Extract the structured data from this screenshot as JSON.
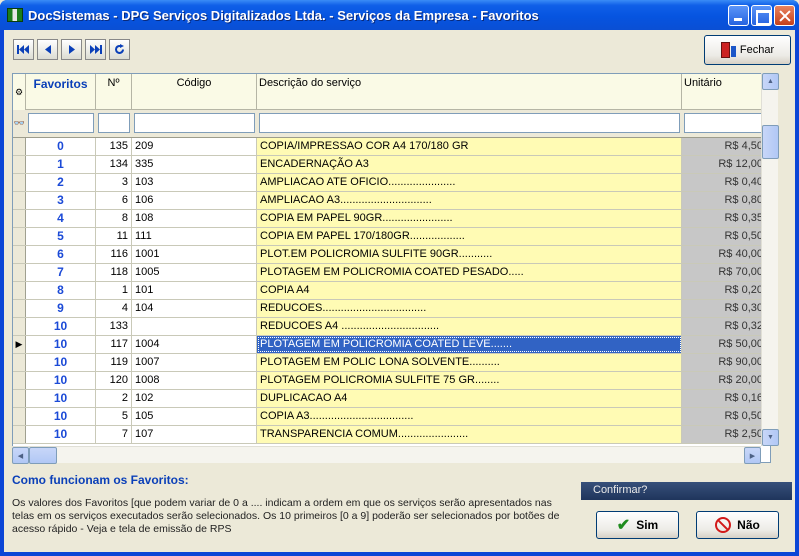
{
  "window": {
    "title": "DocSistemas - DPG Serviços Digitalizados Ltda. - Serviços da Empresa - Favoritos"
  },
  "toolbar": {
    "nav_icons": [
      "first-record-icon",
      "prior-record-icon",
      "next-record-icon",
      "last-record-icon",
      "refresh-icon"
    ],
    "close_label": "Fechar"
  },
  "grid": {
    "columns": [
      "Favoritos",
      "Nº",
      "Código",
      "Descrição do serviço",
      "Unitário"
    ],
    "selected_row": 11,
    "rows": [
      {
        "fav": "0",
        "n": "135",
        "cod": "209",
        "desc": "COPIA/IMPRESSAO COR A4 170/180 GR",
        "unit": "R$ 4,50"
      },
      {
        "fav": "1",
        "n": "134",
        "cod": "335",
        "desc": "ENCADERNAÇÃO A3",
        "unit": "R$ 12,00"
      },
      {
        "fav": "2",
        "n": "3",
        "cod": "103",
        "desc": "AMPLIACAO ATE OFICIO......................",
        "unit": "R$ 0,40"
      },
      {
        "fav": "3",
        "n": "6",
        "cod": "106",
        "desc": "AMPLIACAO A3..............................",
        "unit": "R$ 0,80"
      },
      {
        "fav": "4",
        "n": "8",
        "cod": "108",
        "desc": "COPIA EM PAPEL 90GR.......................",
        "unit": "R$ 0,35"
      },
      {
        "fav": "5",
        "n": "11",
        "cod": "111",
        "desc": "COPIA EM PAPEL 170/180GR..................",
        "unit": "R$ 0,50"
      },
      {
        "fav": "6",
        "n": "116",
        "cod": "1001",
        "desc": "PLOT.EM POLICROMIA SULFITE 90GR...........",
        "unit": "R$ 40,00"
      },
      {
        "fav": "7",
        "n": "118",
        "cod": "1005",
        "desc": "PLOTAGEM EM POLICROMIA COATED PESADO.....",
        "unit": "R$ 70,00"
      },
      {
        "fav": "8",
        "n": "1",
        "cod": "101",
        "desc": "COPIA A4",
        "unit": "R$ 0,20"
      },
      {
        "fav": "9",
        "n": "4",
        "cod": "104",
        "desc": "REDUCOES..................................",
        "unit": "R$ 0,30"
      },
      {
        "fav": "10",
        "n": "133",
        "cod": "",
        "desc": "REDUCOES A4 ................................",
        "unit": "R$ 0,32"
      },
      {
        "fav": "10",
        "n": "117",
        "cod": "1004",
        "desc": "PLOTAGEM EM POLICROMIA COATED LEVE.......",
        "unit": "R$ 50,00"
      },
      {
        "fav": "10",
        "n": "119",
        "cod": "1007",
        "desc": "PLOTAGEM EM POLIC LONA SOLVENTE..........",
        "unit": "R$ 90,00"
      },
      {
        "fav": "10",
        "n": "120",
        "cod": "1008",
        "desc": "PLOTAGEM POLICROMIA SULFITE 75 GR........",
        "unit": "R$ 20,00"
      },
      {
        "fav": "10",
        "n": "2",
        "cod": "102",
        "desc": "DUPLICACAO A4",
        "unit": "R$ 0,16"
      },
      {
        "fav": "10",
        "n": "5",
        "cod": "105",
        "desc": "COPIA A3..................................",
        "unit": "R$ 0,50"
      },
      {
        "fav": "10",
        "n": "7",
        "cod": "107",
        "desc": "TRANSPARENCIA COMUM.......................",
        "unit": "R$ 2,50"
      }
    ]
  },
  "info": {
    "title": "Como funcionam os Favoritos:",
    "text": "Os valores dos Favoritos [que podem variar de 0 a .... indicam a ordem em que os serviços serão apresentados nas telas em os serviços executados serão selecionados.  Os 10 primeiros [0 a 9] poderão ser selecionados por botões de acesso rápido - Veja e tela de emissão de RPS"
  },
  "confirm": {
    "label": "Confirmar?",
    "yes_label": "Sim",
    "no_label": "Não"
  },
  "colors": {
    "accent": "#0a3fb8",
    "favorite_text": "#1b4ad7",
    "description_bg": "#fffbb4",
    "selection": "#3163c4",
    "unit_bg": "#c7c7c7"
  }
}
